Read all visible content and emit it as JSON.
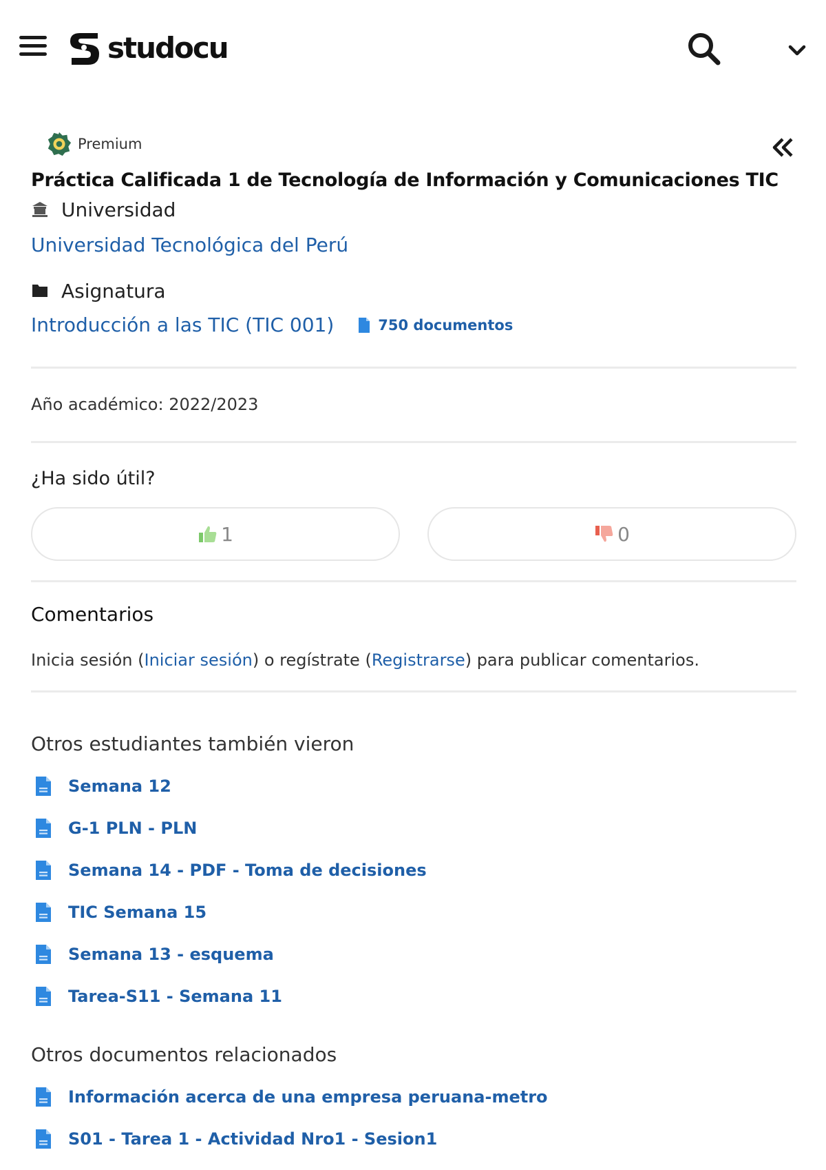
{
  "header": {
    "brand": "studocu",
    "menu_icon": "hamburger-icon",
    "search_icon": "search-icon",
    "dropdown_icon": "chevron-down-icon"
  },
  "badge": {
    "label": "Premium",
    "icon": "premium-gear-icon"
  },
  "document": {
    "title": "Práctica Calificada 1 de Tecnología de Información y Comunicaciones TIC",
    "university_label": "Universidad",
    "university_name": "Universidad Tecnológica del Perú",
    "course_label": "Asignatura",
    "course_name": "Introducción a las TIC (TIC 001)",
    "course_doc_count": "750 documentos",
    "academic_year": "Año académico: 2022/2023"
  },
  "feedback": {
    "question": "¿Ha sido útil?",
    "likes": "1",
    "dislikes": "0"
  },
  "comments": {
    "heading": "Comentarios",
    "text_before_login": "Inicia sesión (",
    "login_link": "Iniciar sesión",
    "text_middle": ") o regístrate (",
    "register_link": "Registrarse",
    "text_after": ") para publicar comentarios."
  },
  "also_viewed": {
    "heading": "Otros estudiantes también vieron",
    "items": [
      "Semana 12",
      "G-1 PLN - PLN",
      "Semana 14 - PDF - Toma de decisiones",
      "TIC Semana 15",
      "Semana 13 - esquema",
      "Tarea-S11 - Semana 11"
    ]
  },
  "related": {
    "heading": "Otros documentos relacionados",
    "items": [
      "Información acerca de una empresa peruana-metro",
      "S01 - Tarea 1 - Actividad Nro1 - Sesion1"
    ]
  },
  "colors": {
    "link": "#1f5fa8",
    "like": "#7cc96a",
    "dislike": "#f08a7e",
    "doc_icon": "#2e88e0"
  }
}
